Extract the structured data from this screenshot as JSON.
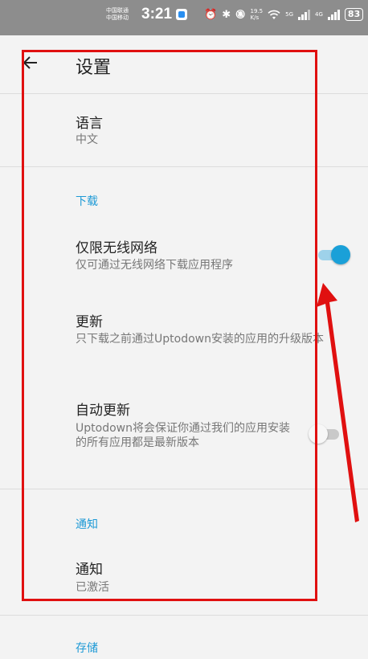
{
  "status_bar": {
    "carrier_1": "中国联通",
    "carrier_2": "中国移动",
    "time": "3:21",
    "alarm_icon": "⏰",
    "bluetooth_icon": "✱",
    "mute_icon": "🔕",
    "net_speed_value": "19.5",
    "net_speed_unit": "K/s",
    "wifi_icon": "wifi-icon",
    "net_5g": "5G",
    "net_4g": "4G",
    "battery": "83"
  },
  "app_bar": {
    "back_icon": "arrow-left-icon",
    "title": "设置"
  },
  "settings": {
    "language": {
      "title": "语言",
      "value": "中文"
    },
    "download_header": "下载",
    "wifi_only": {
      "title": "仅限无线网络",
      "subtitle": "仅可通过无线网络下载应用程序",
      "enabled": true
    },
    "updates": {
      "title": "更新",
      "subtitle": "只下载之前通过Uptodown安装的应用的升级版本"
    },
    "auto_update": {
      "title": "自动更新",
      "subtitle": "Uptodown将会保证你通过我们的应用安装的所有应用都是最新版本",
      "enabled": false
    },
    "notifications_header": "通知",
    "notifications": {
      "title": "通知",
      "value": "已激活"
    },
    "storage_header": "存储"
  },
  "colors": {
    "accent": "#1aa0d8",
    "annotation": "#e01010",
    "background": "#f3f3f3",
    "status_bar": "#8d8d8d"
  }
}
